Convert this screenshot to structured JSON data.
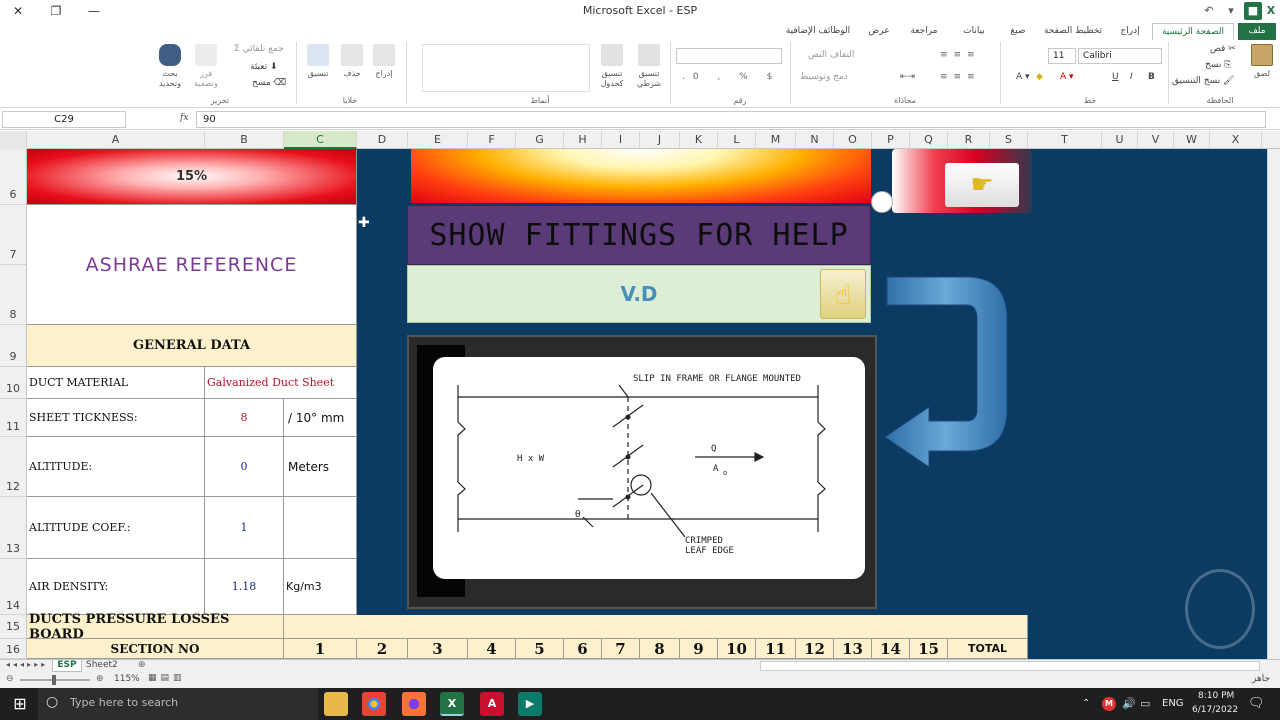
{
  "window": {
    "title": "Microsoft Excel - ESP"
  },
  "ribbon_tabs": [
    "ملف",
    "الصفحة الرئيسية",
    "إدراج",
    "تخطيط الصفحة",
    "صيغ",
    "بيانات",
    "مراجعة",
    "عرض",
    "الوظائف الإضافية"
  ],
  "ribbon": {
    "clipboard": {
      "group": "الحافظة",
      "paste": "لصق",
      "cut": "قص",
      "copy": "نسخ",
      "format_painter": "نسخ التنسيق"
    },
    "font": {
      "group": "خط",
      "name": "Calibri",
      "size": "11"
    },
    "alignment": {
      "group": "محاذاة",
      "wrap": "التفاف النص",
      "merge": "دمج وتوسيط"
    },
    "number": {
      "group": "رقم"
    },
    "styles": {
      "group": "أنماط",
      "conditional": "تنسيق شرطي",
      "as_table": "تنسيق كجدول"
    },
    "cells": {
      "group": "خلايا",
      "insert": "إدراج",
      "delete": "حذف",
      "format": "تنسيق"
    },
    "editing": {
      "group": "تحرير",
      "autosum": "جمع تلقائي",
      "fill": "تعبئة",
      "clear": "مسح",
      "sort": "فرز وتصفية",
      "find": "بحث وتحديد"
    }
  },
  "formula_bar": {
    "name_box": "C29",
    "fx": "fx",
    "value": "90"
  },
  "columns": [
    "A",
    "B",
    "C",
    "D",
    "E",
    "F",
    "G",
    "H",
    "I",
    "J",
    "K",
    "L",
    "M",
    "N",
    "O",
    "P",
    "Q",
    "R",
    "S",
    "T",
    "U",
    "V",
    "W",
    "X"
  ],
  "rows": [
    "6",
    "7",
    "8",
    "9",
    "10",
    "11",
    "12",
    "13",
    "14",
    "15",
    "16"
  ],
  "sheet": {
    "percent_banner": "15%",
    "ashrae": "ASHRAE REFERENCE",
    "general_data": "GENERAL DATA",
    "duct_material_label": "DUCT MATERIAL",
    "duct_material_value": "Galvanized Duct Sheet",
    "sheet_thickness_label": "SHEET TICKNESS:",
    "sheet_thickness_value": "8",
    "sheet_thickness_unit": "/ 10° mm",
    "altitude_label": "ALTITUDE:",
    "altitude_value": "0",
    "altitude_unit": "Meters",
    "altitude_coef_label": "ALTITUDE COEF.:",
    "altitude_coef_value": "1",
    "air_density_label": "AIR DENSITY:",
    "air_density_value": "1.18",
    "air_density_unit": "Kg/m3",
    "board_title": "DUCTS PRESSURE LOSSES BOARD",
    "section_no": "SECTION NO",
    "sections": [
      "1",
      "2",
      "3",
      "4",
      "5",
      "6",
      "7",
      "8",
      "9",
      "10",
      "11",
      "12",
      "13",
      "14",
      "15"
    ],
    "total": "TOTAL",
    "show_fittings": "SHOW FITTINGS FOR HELP",
    "fitting_name": "V.D",
    "drawing": {
      "label_top": "SLIP IN FRAME OR FLANGE MOUNTED",
      "hw": "H x W",
      "q": "Q",
      "ao": "A",
      "ao_sub": "o",
      "theta": "θ",
      "crimped": "CRIMPED",
      "leaf": "LEAF EDGE"
    }
  },
  "sheet_tabs": [
    "ESP",
    "Sheet2"
  ],
  "status": {
    "zoom": "115%",
    "ready": "جاهز"
  },
  "taskbar": {
    "search_placeholder": "Type here to search",
    "lang": "ENG",
    "time": "8:10 PM",
    "date": "6/17/2022"
  },
  "colors": {
    "excel_green": "#217346",
    "sheet_bg": "#0b3a63",
    "purple_banner": "#5b3a78",
    "ashrae_text": "#7b3a97"
  }
}
